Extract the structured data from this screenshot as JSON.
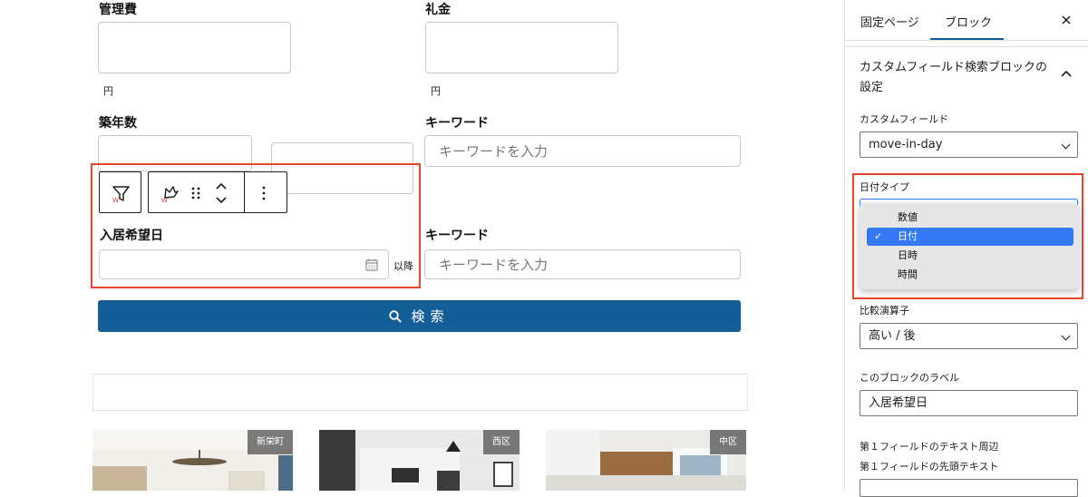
{
  "form": {
    "management_fee_label": "管理費",
    "key_money_label": "礼金",
    "unit_yen": "円",
    "building_age_label": "築年数",
    "keyword_label": "キーワード",
    "keyword_placeholder": "キーワードを入力",
    "move_in_label": "入居希望日",
    "after_text": "以降",
    "keyword2_label": "キーワード",
    "keyword2_placeholder": "キーワードを入力",
    "search_button": "検索"
  },
  "listings": [
    {
      "area": "新栄町"
    },
    {
      "area": "西区"
    },
    {
      "area": "中区"
    }
  ],
  "sidebar": {
    "tabs": [
      "固定ページ",
      "ブロック"
    ],
    "active_tab": "ブロック",
    "panel_title_line1": "カスタムフィールド検索ブロックの",
    "panel_title_line2": "設定",
    "custom_field_label": "カスタムフィールド",
    "custom_field_value": "move-in-day",
    "date_type_label": "日付タイプ",
    "date_type_options": [
      "数値",
      "日付",
      "日時",
      "時間"
    ],
    "date_type_selected": "日付",
    "comparison_label": "比較演算子",
    "comparison_value": "高い / 後",
    "block_label_label": "このブロックのラベル",
    "block_label_value": "入居希望日",
    "first_field_text_label": "第１フィールドのテキスト周辺",
    "first_field_prefix_label": "第１フィールドの先頭テキスト"
  },
  "colors": {
    "primary": "#135e96",
    "highlight": "#e8452c",
    "selected_option": "#3478f6"
  }
}
